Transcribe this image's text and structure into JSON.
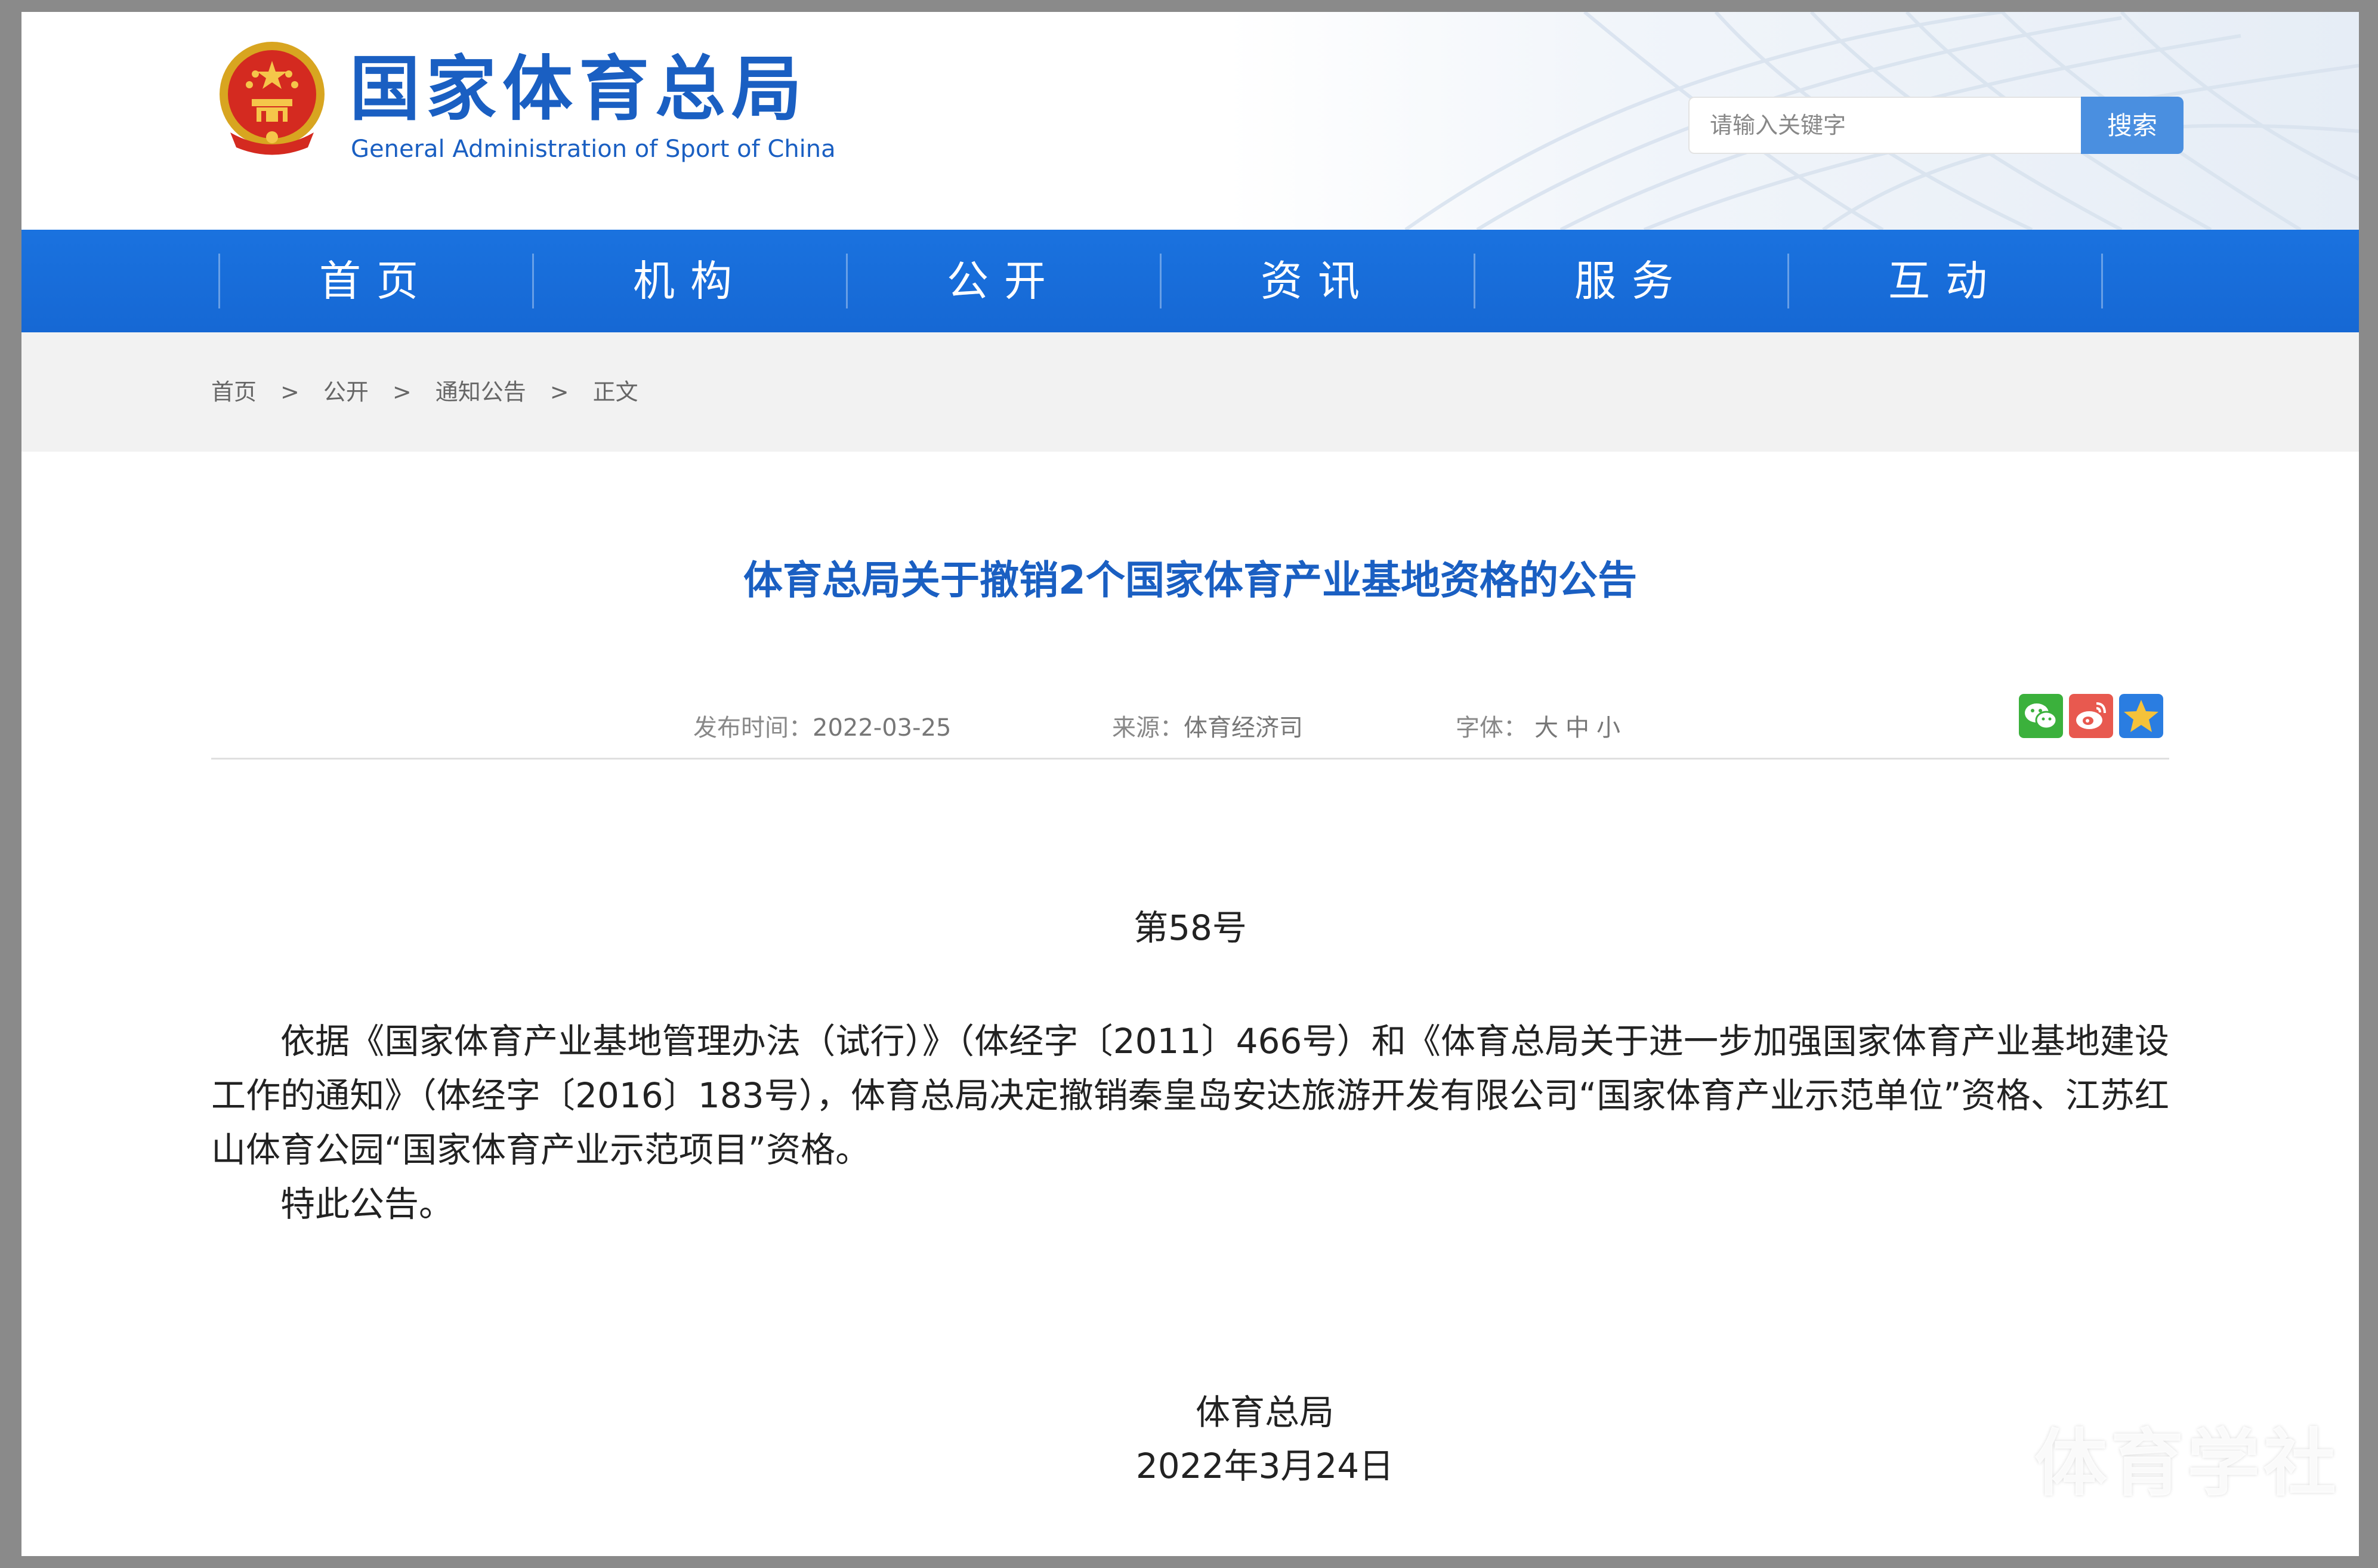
{
  "header": {
    "site_name": "国家体育总局",
    "site_name_en": "General Administration of Sport of China",
    "search": {
      "placeholder": "请输入关键字",
      "button": "搜索"
    }
  },
  "nav": {
    "items": [
      {
        "label": "首页"
      },
      {
        "label": "机构"
      },
      {
        "label": "公开"
      },
      {
        "label": "资讯"
      },
      {
        "label": "服务"
      },
      {
        "label": "互动"
      }
    ]
  },
  "breadcrumb": {
    "items": [
      "首页",
      "公开",
      "通知公告",
      "正文"
    ],
    "separator": ">"
  },
  "article": {
    "title": "体育总局关于撤销2个国家体育产业基地资格的公告",
    "meta": {
      "publish_label": "发布时间：",
      "publish_date": "2022-03-25",
      "source_label": "来源：",
      "source": "体育经济司",
      "font_label": "字体：",
      "font_sizes": [
        "大",
        "中",
        "小"
      ]
    },
    "share_icons": [
      "wechat-icon",
      "weibo-icon",
      "favorite-star-icon"
    ],
    "doc_number": "第58号",
    "paragraphs": [
      "依据《国家体育产业基地管理办法（试行）》（体经字〔2011〕466号）和《体育总局关于进一步加强国家体育产业基地建设工作的通知》（体经字〔2016〕183号），体育总局决定撤销秦皇岛安达旅游开发有限公司“国家体育产业示范单位”资格、江苏红山体育公园“国家体育产业示范项目”资格。",
      "特此公告。"
    ],
    "signature": "体育总局",
    "date": "2022年3月24日"
  },
  "watermark": "体育学社",
  "colors": {
    "brand_blue": "#1a5fc2",
    "nav_blue": "#1668d4",
    "search_button": "#4a8fe0",
    "wechat_green": "#3bb13c",
    "weibo_red": "#e8594f",
    "favorite_blue": "#2a7de1"
  }
}
